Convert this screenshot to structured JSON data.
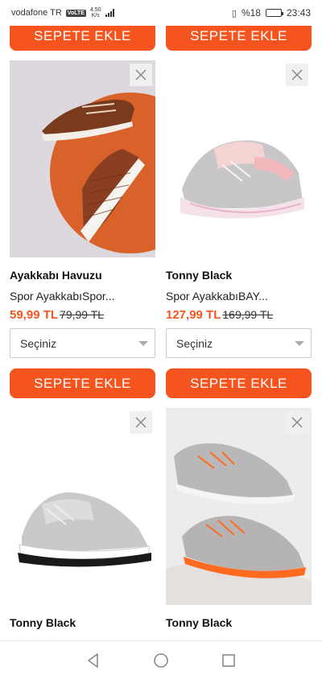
{
  "status_bar": {
    "carrier": "vodafone TR",
    "volte": "VoLTE",
    "net_speed": "4.50",
    "net_unit": "K/s",
    "battery_text": "%18",
    "time": "23:43",
    "battery_percent": 18
  },
  "products": [
    {
      "cart_label": "SEPETE EKLE"
    },
    {
      "cart_label": "SEPETE EKLE"
    },
    {
      "brand": "Ayakkabı Havuzu",
      "name": "Spor AyakkabıSpor...",
      "price": "59,99 TL",
      "old_price": "79,99 TL",
      "select_value": "Seçiniz",
      "cart_label": "SEPETE EKLE",
      "image": "brown-leather-sneakers"
    },
    {
      "brand": "Tonny Black",
      "name": "Spor AyakkabıBAY...",
      "price": "127,99 TL",
      "old_price": "169,99 TL",
      "select_value": "Seçiniz",
      "cart_label": "SEPETE EKLE",
      "image": "grey-pink-chunky-sneaker"
    },
    {
      "brand": "Tonny Black",
      "image": "grey-white-black-sneaker"
    },
    {
      "brand": "Tonny Black",
      "image": "grey-orange-knit-sneakers"
    }
  ],
  "colors": {
    "accent": "#f5541f"
  },
  "icons": {
    "remove": "close-icon",
    "back": "back-triangle-icon",
    "home": "home-circle-icon",
    "recents": "recents-square-icon"
  }
}
